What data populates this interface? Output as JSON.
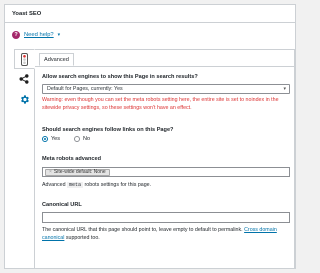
{
  "metabox": {
    "title": "Yoast SEO"
  },
  "help": {
    "link_label": "Need help?",
    "chevron": "▾"
  },
  "side_tabs": [
    {
      "icon": "traffic-light-icon"
    },
    {
      "icon": "share-icon"
    },
    {
      "icon": "gear-icon"
    }
  ],
  "panel": {
    "tab_label": "Advanced",
    "search_results": {
      "label": "Allow search engines to show this Page in search results?",
      "selected": "Default for Pages, currently: Yes",
      "warning_line1": "Warning: even though you can set the meta robots setting here, the entire site is set to noindex in the",
      "warning_line2": "sitewide privacy settings, so these settings won't have an effect."
    },
    "follow_links": {
      "label": "Should search engines follow links on this Page?",
      "options": [
        {
          "label": "Yes",
          "checked": true
        },
        {
          "label": "No",
          "checked": false
        }
      ]
    },
    "meta_robots": {
      "label": "Meta robots advanced",
      "chip_label": "Site-wide default: None",
      "chip_remove": "×",
      "desc_before": "Advanced",
      "desc_code": "meta",
      "desc_after": "robots settings for this page."
    },
    "canonical": {
      "label": "Canonical URL",
      "value": "",
      "desc_line1": "The canonical URL that this page should point to, leave empty to default to permalink.",
      "desc_link1": "Cross domain",
      "desc_link2": "canonical",
      "desc_after": "supported too."
    }
  },
  "colors": {
    "accent": "#0073aa",
    "warning": "#dc3232",
    "help_badge": "#a4286a"
  }
}
